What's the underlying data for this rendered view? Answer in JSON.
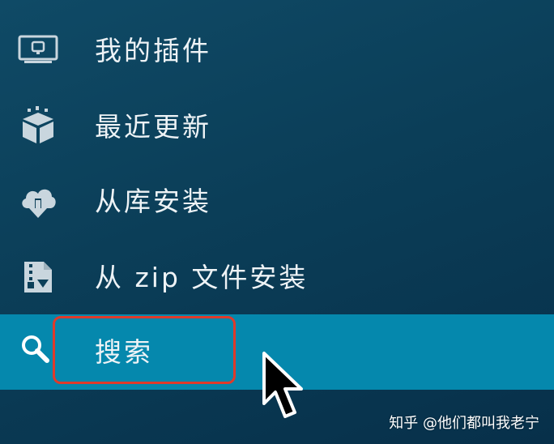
{
  "menu": {
    "items": [
      {
        "label": "我的插件",
        "icon": "tv-icon",
        "selected": false
      },
      {
        "label": "最近更新",
        "icon": "box-update-icon",
        "selected": false
      },
      {
        "label": "从库安装",
        "icon": "cloud-download-icon",
        "selected": false
      },
      {
        "label": "从 zip 文件安装",
        "icon": "zip-file-icon",
        "selected": false
      },
      {
        "label": "搜索",
        "icon": "search-icon",
        "selected": true
      }
    ]
  },
  "watermark": "知乎 @他们都叫我老宁",
  "colors": {
    "background": "#0b3e58",
    "selected_row": "#0588ad",
    "highlight_border": "#e03a2a",
    "text": "#eef3f6"
  }
}
